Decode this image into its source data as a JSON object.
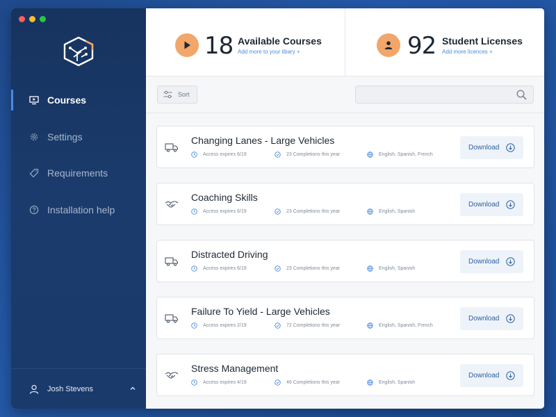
{
  "colors": {
    "accent": "#4a8be0",
    "orange": "#f2a66a",
    "sidebar": "#1a3a6b"
  },
  "sidebar": {
    "logo_icon": "circuit-hexagon-logo",
    "items": [
      {
        "label": "Courses",
        "icon": "presentation-icon",
        "active": true
      },
      {
        "label": "Settings",
        "icon": "gear-icon",
        "active": false
      },
      {
        "label": "Requirements",
        "icon": "tag-icon",
        "active": false
      },
      {
        "label": "Installation help",
        "icon": "help-circle-icon",
        "active": false
      }
    ],
    "user": {
      "name": "Josh Stevens",
      "icon": "user-icon"
    }
  },
  "stats": {
    "courses": {
      "count": "18",
      "title": "Available Courses",
      "link": "Add more to your libary +",
      "icon": "play-icon"
    },
    "licenses": {
      "count": "92",
      "title": "Student Licenses",
      "link": "Add more licences +",
      "icon": "user-icon"
    }
  },
  "toolbar": {
    "sort_label": "Sort",
    "search_value": ""
  },
  "courses": [
    {
      "title": "Changing Lanes - Large Vehicles",
      "icon": "truck-icon",
      "access": "Access expires 6/19",
      "completions": "23 Completions this year",
      "languages": "English, Spanish, French",
      "button": "Download"
    },
    {
      "title": "Coaching Skills",
      "icon": "handshake-icon",
      "access": "Access expires 6/19",
      "completions": "23 Completions this year",
      "languages": "English, Spanish",
      "button": "Download"
    },
    {
      "title": "Distracted Driving",
      "icon": "truck-icon",
      "access": "Access expires 6/19",
      "completions": "23 Completions this year",
      "languages": "English, Spanish",
      "button": "Download"
    },
    {
      "title": "Failure To Yield - Large Vehicles",
      "icon": "truck-icon",
      "access": "Access expires 2/19",
      "completions": "72 Completions this year",
      "languages": "English, Spanish, French",
      "button": "Download"
    },
    {
      "title": "Stress Management",
      "icon": "handshake-icon",
      "access": "Access expires 4/19",
      "completions": "46 Completions this year",
      "languages": "English, Spanish",
      "button": "Download"
    }
  ]
}
